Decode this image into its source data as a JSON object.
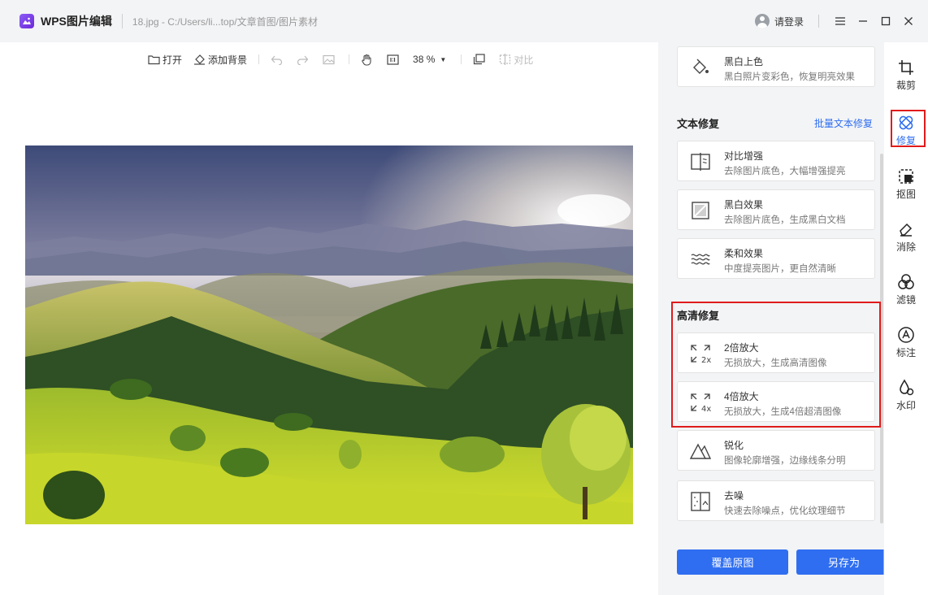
{
  "titlebar": {
    "app_title": "WPS图片编辑",
    "file_path": "18.jpg - C:/Users/li...top/文章首图/图片素材",
    "login": "请登录",
    "icons": [
      "menu-icon",
      "minimize-icon",
      "maximize-icon",
      "close-icon"
    ]
  },
  "toolbar": {
    "open": "打开",
    "add_background": "添加背景",
    "zoom": "38 %",
    "compare": "对比"
  },
  "panel": {
    "top_card": {
      "title": "黑白上色",
      "desc": "黑白照片变彩色，恢复明亮效果"
    },
    "text_section": {
      "title": "文本修复",
      "link": "批量文本修复"
    },
    "text_cards": [
      {
        "title": "对比增强",
        "desc": "去除图片底色，大幅增强提亮"
      },
      {
        "title": "黑白效果",
        "desc": "去除图片底色，生成黑白文档"
      },
      {
        "title": "柔和效果",
        "desc": "中度提亮图片，更自然清晰"
      }
    ],
    "hd_section": {
      "title": "高清修复"
    },
    "hd_cards": [
      {
        "title": "2倍放大",
        "desc": "无损放大，生成高清图像",
        "icon_label": "2x"
      },
      {
        "title": "4倍放大",
        "desc": "无损放大，生成4倍超清图像",
        "icon_label": "4x"
      }
    ],
    "other_cards": [
      {
        "title": "锐化",
        "desc": "图像轮廓增强，边缘线条分明"
      },
      {
        "title": "去噪",
        "desc": "快速去除噪点，优化纹理细节"
      }
    ],
    "cover_button": "覆盖原图",
    "save_as_button": "另存为"
  },
  "sidenav": {
    "items": [
      {
        "label": "裁剪"
      },
      {
        "label": "修复"
      },
      {
        "label": "抠图"
      },
      {
        "label": "消除"
      },
      {
        "label": "滤镜"
      },
      {
        "label": "标注"
      },
      {
        "label": "水印"
      }
    ],
    "active": "修复"
  },
  "colors": {
    "accent": "#2f6ef0",
    "highlight": "#e01b1b",
    "panel_bg": "#f3f4f6"
  }
}
